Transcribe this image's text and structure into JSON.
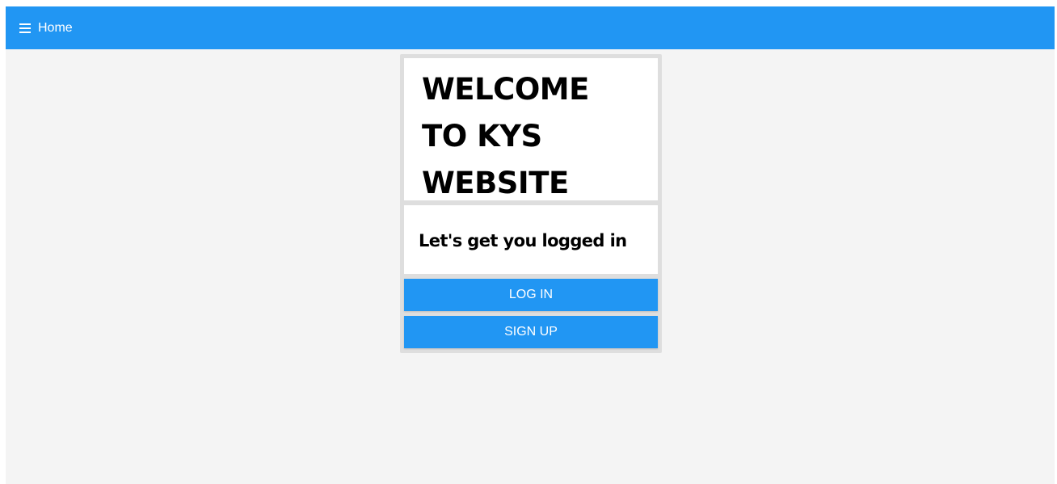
{
  "appbar": {
    "menu_icon": "hamburger-menu-icon",
    "title": "Home",
    "color": "#2196f3"
  },
  "card": {
    "welcome_lines": [
      "WELCOME",
      "TO KYS",
      "WEBSITE"
    ],
    "subtitle": "Let's get you logged in",
    "login_label": "LOG IN",
    "signup_label": "SIGN UP"
  },
  "colors": {
    "accent": "#2196f3",
    "background": "#f4f4f4",
    "card_border": "#dedede"
  }
}
